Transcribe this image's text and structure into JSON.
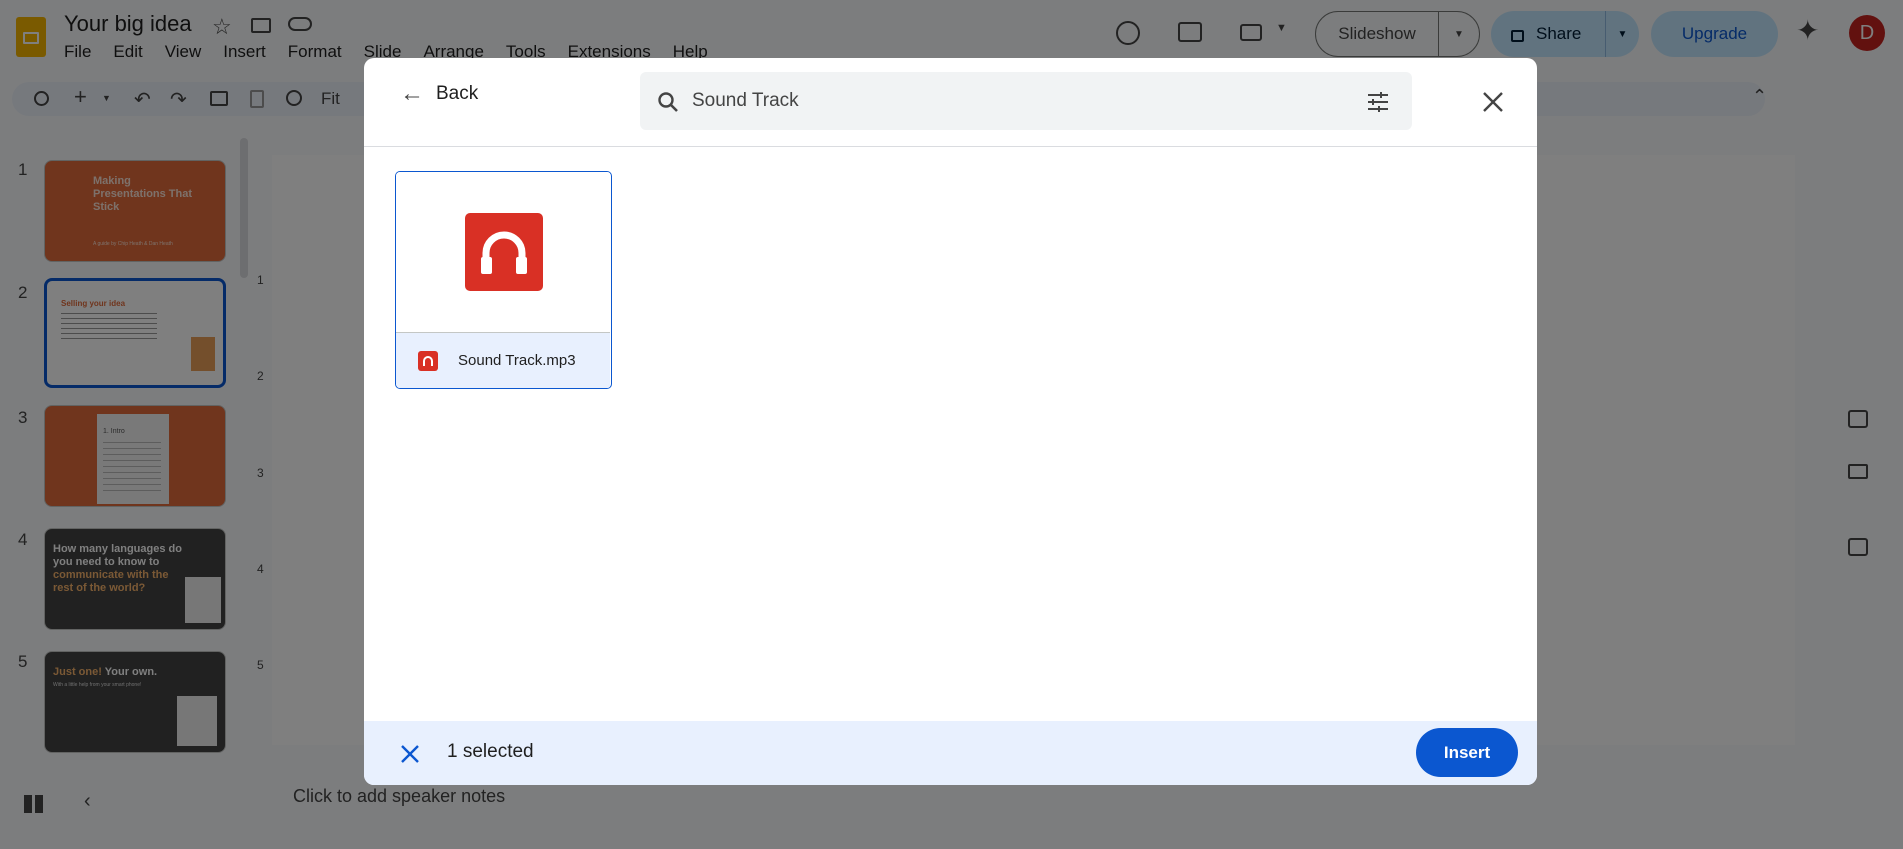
{
  "app": {
    "doc_title": "Your big idea",
    "menus": [
      "File",
      "Edit",
      "View",
      "Insert",
      "Format",
      "Slide",
      "Arrange",
      "Tools",
      "Extensions",
      "Help"
    ],
    "slideshow_label": "Slideshow",
    "share_label": "Share",
    "upgrade_label": "Upgrade",
    "avatar_letter": "D",
    "zoom_label": "Fit",
    "speaker_notes": "Click to add speaker notes",
    "ruler_marks": [
      "1",
      "2",
      "3",
      "4",
      "5"
    ]
  },
  "slides": [
    {
      "num": "1",
      "title": "Making Presentations That Stick",
      "subtitle": "A guide by Chip Heath & Dan Heath"
    },
    {
      "num": "2",
      "title": "Selling your idea"
    },
    {
      "num": "3",
      "title": "1. Intro"
    },
    {
      "num": "4",
      "title_white": "How many languages do you need to know to",
      "title_orange": "communicate with the rest of the world?"
    },
    {
      "num": "5",
      "title_orange": "Just one!",
      "title_white": "Your own.",
      "subtitle": "With a little help from your smart phone!"
    }
  ],
  "dialog": {
    "back_label": "Back",
    "search_value": "Sound Track",
    "file": {
      "name": "Sound Track.mp3",
      "icon": "headphones-icon"
    },
    "selected_text": "1 selected",
    "insert_label": "Insert"
  },
  "colors": {
    "accent": "#0b57d0",
    "audio_red": "#d93025",
    "slide_orange": "#e06a3a",
    "slide_dark": "#434343"
  }
}
